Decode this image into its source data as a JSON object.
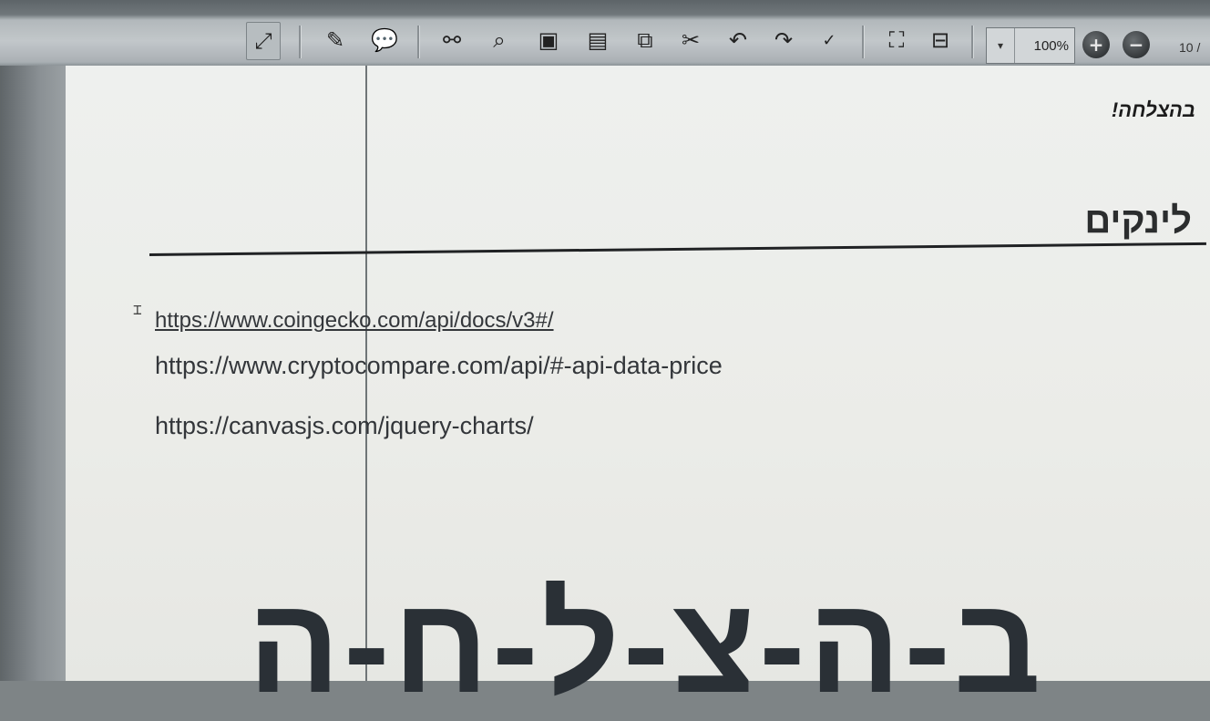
{
  "toolbar": {
    "zoom": "100%",
    "zoom_in": "+",
    "zoom_out": "−",
    "page_count": "10 /"
  },
  "document": {
    "note": "בהצלחה!",
    "heading": "לינקים",
    "links": [
      "https://www.coingecko.com/api/docs/v3#/",
      "https://www.cryptocompare.com/api/#-api-data-price",
      "https://canvasjs.com/jquery-charts/"
    ],
    "banner": "ב-ה-צ-ל-ח-ה"
  }
}
